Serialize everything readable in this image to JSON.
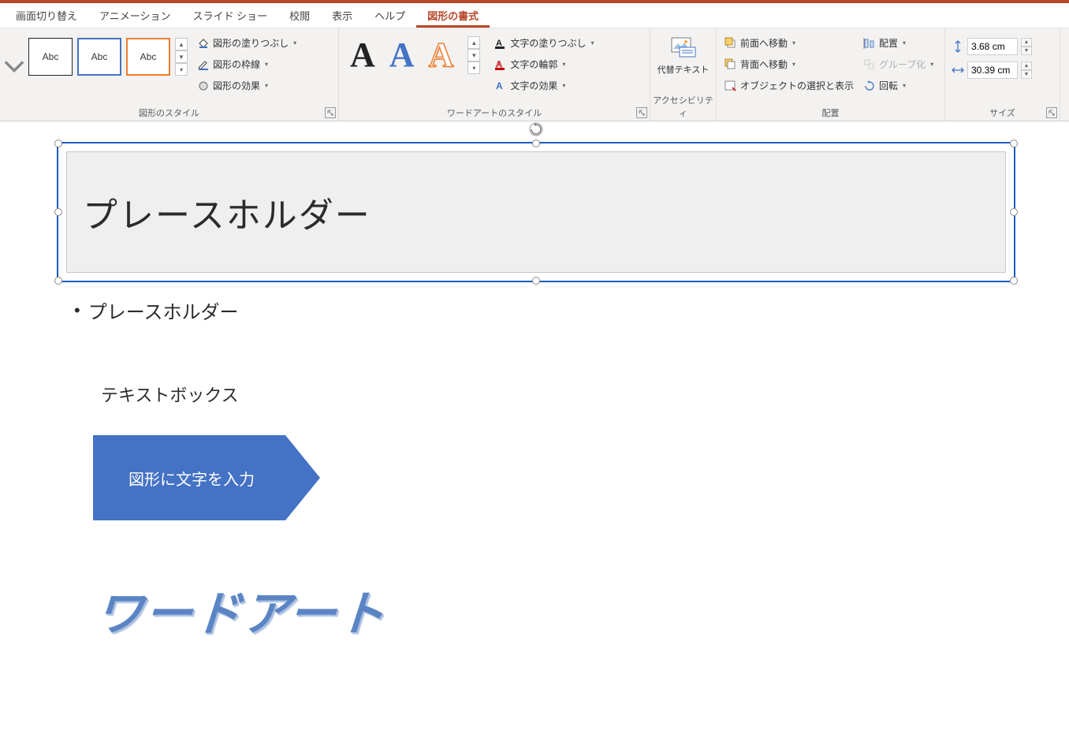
{
  "tabs": {
    "t0": "画面切り替え",
    "t1": "アニメーション",
    "t2": "スライド ショー",
    "t3": "校閲",
    "t4": "表示",
    "t5": "ヘルプ",
    "t6": "図形の書式"
  },
  "ribbon": {
    "shapeStyles": {
      "label": "図形のスタイル",
      "abc": "Abc",
      "fill": "図形の塗りつぶし",
      "outline": "図形の枠線",
      "effects": "図形の効果"
    },
    "wordart": {
      "label": "ワードアートのスタイル",
      "sample": "A",
      "textFill": "文字の塗りつぶし",
      "textOutline": "文字の輪郭",
      "textEffects": "文字の効果"
    },
    "accessibility": {
      "label": "アクセシビリティ",
      "altText": "代替テキスト"
    },
    "arrange": {
      "label": "配置",
      "bringForward": "前面へ移動",
      "sendBackward": "背面へ移動",
      "selectionPane": "オブジェクトの選択と表示",
      "align": "配置",
      "group": "グループ化",
      "rotate": "回転"
    },
    "size": {
      "label": "サイズ",
      "height": "3.68 cm",
      "width": "30.39 cm"
    }
  },
  "slide": {
    "placeholderTitle": "プレースホルダー",
    "bulletText": "プレースホルダー",
    "textBox": "テキストボックス",
    "shapeText": "図形に文字を入力",
    "wordArt": "ワードアート"
  }
}
